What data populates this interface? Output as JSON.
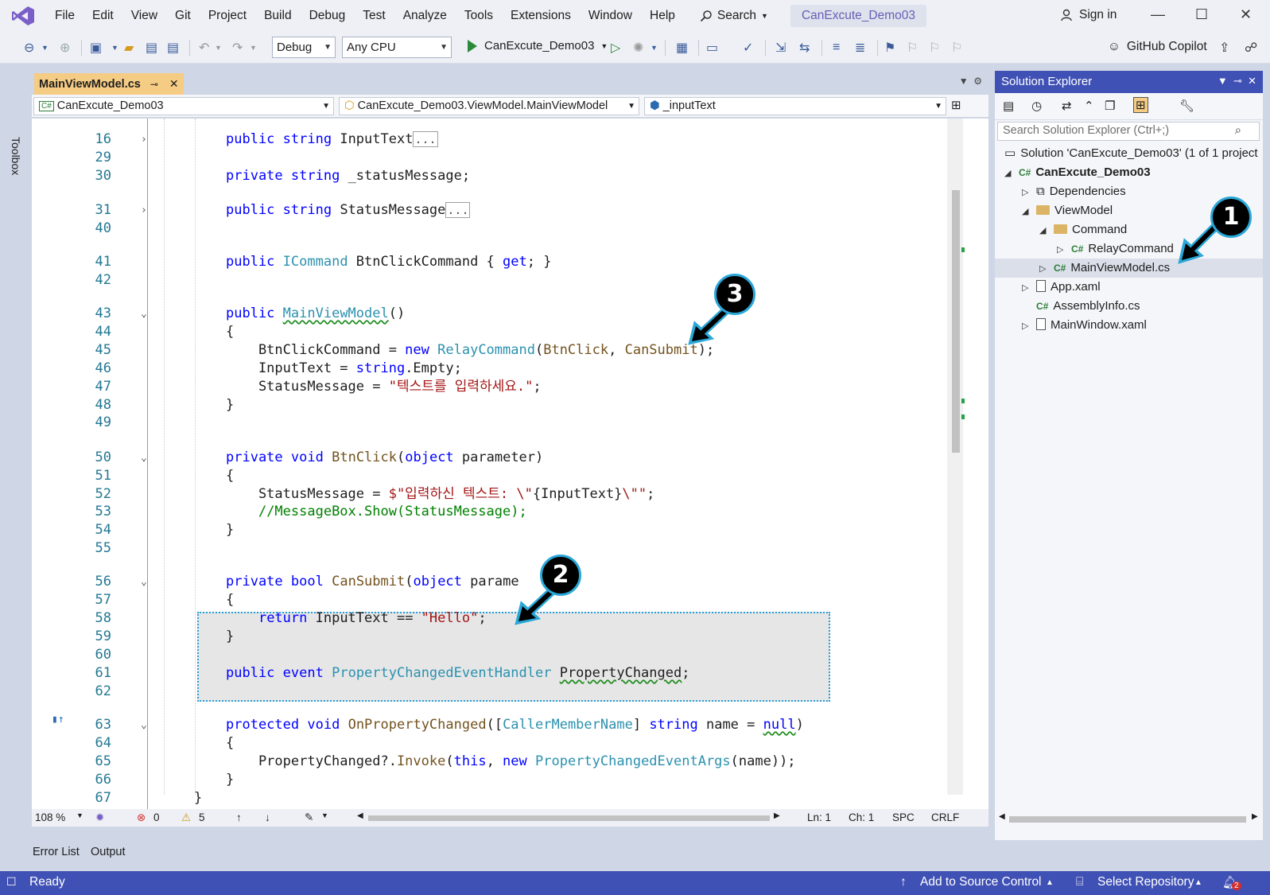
{
  "menu": [
    "File",
    "Edit",
    "View",
    "Git",
    "Project",
    "Build",
    "Debug",
    "Test",
    "Analyze",
    "Tools",
    "Extensions",
    "Window",
    "Help"
  ],
  "search_label": "Search",
  "solution_title": "CanExcute_Demo03",
  "sign_in": "Sign in",
  "toolbar": {
    "config": "Debug",
    "platform": "Any CPU",
    "start_target": "CanExcute_Demo03",
    "copilot": "GitHub Copilot"
  },
  "toolbox_label": "Toolbox",
  "editor": {
    "tab": "MainViewModel.cs",
    "nav_project": "CanExcute_Demo03",
    "nav_class": "CanExcute_Demo03.ViewModel.MainViewModel",
    "nav_member": "_inputText",
    "lines": [
      {
        "n": "16",
        "fold": "›",
        "html": "<span class=\"kw\">public</span> <span class=\"kw\">string</span> InputText<span class=\"coll\">...</span>"
      },
      {
        "n": "29",
        "fold": "",
        "html": ""
      },
      {
        "n": "30",
        "fold": "",
        "html": "<span class=\"kw\">private</span> <span class=\"kw\">string</span> _statusMessage;"
      },
      {
        "n": "31",
        "fold": "›",
        "html": "<span class=\"kw\">public</span> <span class=\"kw\">string</span> StatusMessage<span class=\"coll\">...</span>"
      },
      {
        "n": "40",
        "fold": "",
        "html": ""
      },
      {
        "n": "41",
        "fold": "",
        "html": "<span class=\"kw\">public</span> <span class=\"ty\">ICommand</span> BtnClickCommand { <span class=\"kw\">get</span>; }"
      },
      {
        "n": "42",
        "fold": "",
        "html": ""
      },
      {
        "n": "43",
        "fold": "⌄",
        "html": "<span class=\"kw\">public</span> <span class=\"ty sq\">MainViewModel</span>()"
      },
      {
        "n": "44",
        "fold": "",
        "html": "{"
      },
      {
        "n": "45",
        "fold": "",
        "html": "    BtnClickCommand = <span class=\"kw\">new</span> <span class=\"ty\">RelayCommand</span>(<span class=\"mt\">BtnClick</span>, <span class=\"mt\">CanSubmit</span>);"
      },
      {
        "n": "46",
        "fold": "",
        "html": "    InputText = <span class=\"kw\">string</span>.Empty;"
      },
      {
        "n": "47",
        "fold": "",
        "html": "    StatusMessage = <span class=\"str\">\"텍스트를 입력하세요.\"</span>;"
      },
      {
        "n": "48",
        "fold": "",
        "html": "}"
      },
      {
        "n": "49",
        "fold": "",
        "html": ""
      },
      {
        "n": "50",
        "fold": "⌄",
        "html": "<span class=\"kw\">private</span> <span class=\"kw\">void</span> <span class=\"mt\">BtnClick</span>(<span class=\"kw\">object</span> parameter)"
      },
      {
        "n": "51",
        "fold": "",
        "html": "{"
      },
      {
        "n": "52",
        "fold": "",
        "html": "    StatusMessage = <span class=\"str\">$\"입력하신 텍스트: \\\"</span>{InputText}<span class=\"str\">\\\"\"</span>;"
      },
      {
        "n": "53",
        "fold": "",
        "html": "    <span class=\"cm\">//MessageBox.Show(StatusMessage);</span>"
      },
      {
        "n": "54",
        "fold": "",
        "html": "}"
      },
      {
        "n": "55",
        "fold": "",
        "html": ""
      },
      {
        "n": "56",
        "fold": "⌄",
        "html": "<span class=\"kw\">private</span> <span class=\"kw\">bool</span> <span class=\"mt\">CanSubmit</span>(<span class=\"kw\">object</span> parame"
      },
      {
        "n": "57",
        "fold": "",
        "html": "{"
      },
      {
        "n": "58",
        "fold": "",
        "html": "    <span class=\"kw\">return</span> InputText == <span class=\"str\">\"Hello\"</span>;"
      },
      {
        "n": "59",
        "fold": "",
        "html": "}"
      },
      {
        "n": "60",
        "fold": "",
        "html": ""
      },
      {
        "n": "61",
        "fold": "",
        "html": "<span class=\"kw\">public</span> <span class=\"kw\">event</span> <span class=\"ty\">PropertyChangedEventHandler</span> <span class=\"sq\">PropertyChanged</span>;"
      },
      {
        "n": "62",
        "fold": "",
        "html": ""
      },
      {
        "n": "63",
        "fold": "⌄",
        "html": "<span class=\"kw\">protected</span> <span class=\"kw\">void</span> <span class=\"mt\">OnPropertyChanged</span>([<span class=\"ty\">CallerMemberName</span>] <span class=\"kw\">string</span> name = <span class=\"kw sq\">null</span>)"
      },
      {
        "n": "64",
        "fold": "",
        "html": "{"
      },
      {
        "n": "65",
        "fold": "",
        "html": "    PropertyChanged?.<span class=\"mt\">Invoke</span>(<span class=\"kw\">this</span>, <span class=\"kw\">new</span> <span class=\"ty\">PropertyChangedEventArgs</span>(name));"
      },
      {
        "n": "66",
        "fold": "",
        "html": "}"
      },
      {
        "n": "67",
        "fold": "",
        "html": "}"
      }
    ],
    "zoom": "108 %",
    "errors": "0",
    "warnings": "5",
    "ln": "Ln: 1",
    "ch": "Ch: 1",
    "spc": "SPC",
    "crlf": "CRLF"
  },
  "bottom_tabs": [
    "Error List",
    "Output"
  ],
  "status": {
    "ready": "Ready",
    "source_control": "Add to Source Control",
    "repository": "Select Repository",
    "notifications": "2"
  },
  "solution_explorer": {
    "title": "Solution Explorer",
    "search_placeholder": "Search Solution Explorer (Ctrl+;)",
    "solution": "Solution 'CanExcute_Demo03' (1 of 1 project",
    "project": "CanExcute_Demo03",
    "dependencies": "Dependencies",
    "viewmodel": "ViewModel",
    "command": "Command",
    "relay": "RelayCommand",
    "mainvm": "MainViewModel.cs",
    "app": "App.xaml",
    "assembly": "AssemblyInfo.cs",
    "mainwindow": "MainWindow.xaml"
  },
  "callouts": [
    "1",
    "2",
    "3"
  ]
}
